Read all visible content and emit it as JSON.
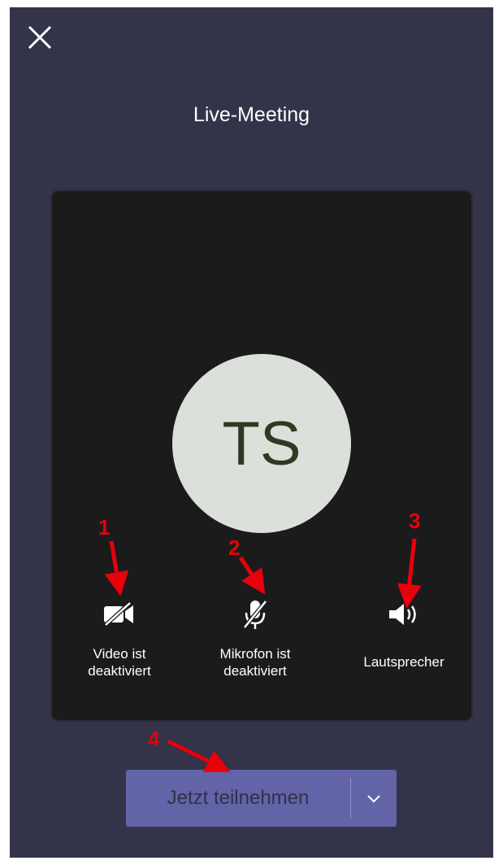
{
  "header": {
    "title": "Live-Meeting"
  },
  "preview": {
    "avatar_initials": "TS"
  },
  "controls": {
    "video": {
      "line1": "Video ist",
      "line2": "deaktiviert",
      "icon": "video-off-icon"
    },
    "mic": {
      "line1": "Mikrofon ist",
      "line2": "deaktiviert",
      "icon": "mic-off-icon"
    },
    "speaker": {
      "label": "Lautsprecher",
      "icon": "speaker-icon"
    }
  },
  "join": {
    "label": "Jetzt teilnehmen",
    "dropdown_icon": "chevron-down-icon"
  },
  "annotations": {
    "one": "1",
    "two": "2",
    "three": "3",
    "four": "4"
  },
  "colors": {
    "background": "#33334a",
    "preview": "#1b1b1b",
    "accent": "#6264a7",
    "annotation": "#e8000b"
  }
}
